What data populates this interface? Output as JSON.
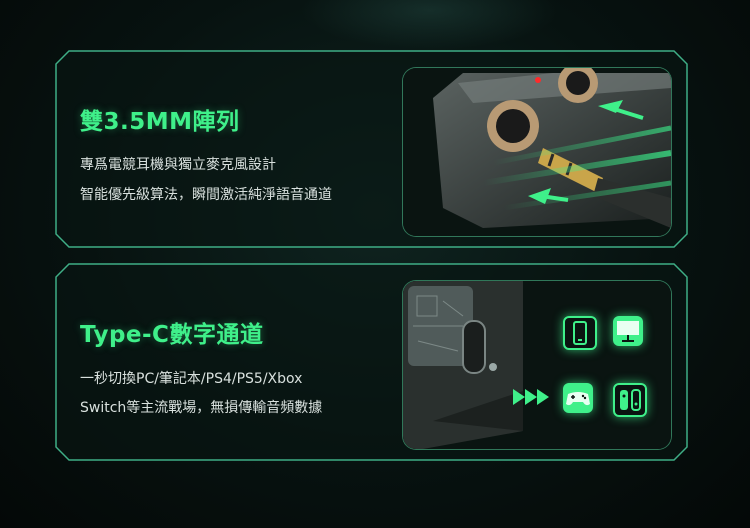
{
  "panels": [
    {
      "title": "雙3.5MM陣列",
      "lines": [
        "專爲電競耳機與獨立麥克風設計",
        "智能優先級算法，瞬間激活純淨語音通道"
      ],
      "image": "3.5mm-jack-illustration"
    },
    {
      "title": "Type-C數字通道",
      "lines": [
        "一秒切換PC/筆記本/PS4/PS5/Xbox",
        "Switch等主流戰場，無損傳輸音頻數據"
      ],
      "image": "type-c-port-illustration",
      "devices": [
        "phone-icon",
        "monitor-icon",
        "gamepad-icon",
        "switch-console-icon"
      ]
    }
  ],
  "colors": {
    "accent": "#3ff08a",
    "frame": "#3fae86",
    "text": "#d8e0dd"
  }
}
